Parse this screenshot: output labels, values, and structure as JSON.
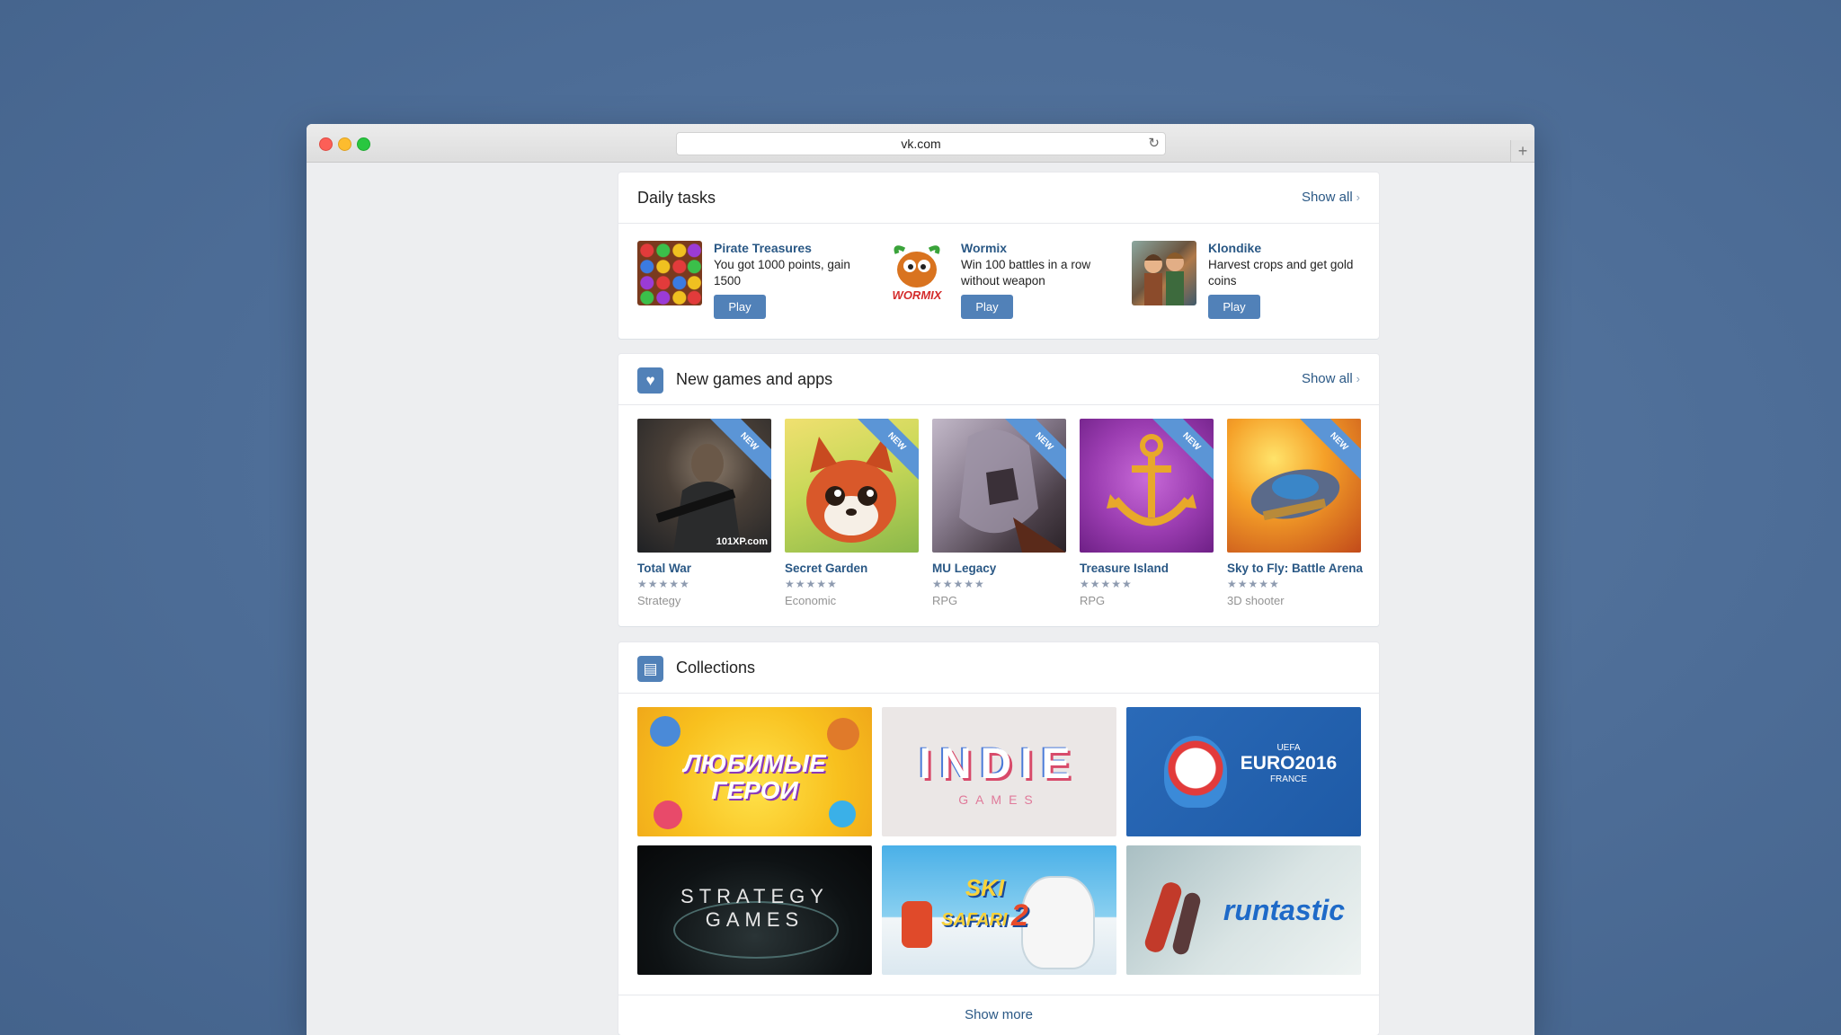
{
  "browser": {
    "url": "vk.com",
    "reload_icon": "↻",
    "new_tab_icon": "+"
  },
  "daily_tasks": {
    "title": "Daily tasks",
    "show_all": "Show all",
    "tasks": [
      {
        "name": "Pirate Treasures",
        "desc": "You got 1000 points, gain 1500",
        "button": "Play"
      },
      {
        "name": "Wormix",
        "desc": "Win 100 battles in a row without weapon",
        "button": "Play",
        "logo_text": "WORMIX"
      },
      {
        "name": "Klondike",
        "desc": "Harvest crops and get gold coins",
        "button": "Play"
      }
    ]
  },
  "new_games": {
    "title": "New games and apps",
    "show_all": "Show all",
    "games": [
      {
        "name": "Total War",
        "genre": "Strategy",
        "badge": "NEW",
        "rating": 4.5,
        "stars": "★★★★★",
        "watermark": "101XP.com"
      },
      {
        "name": "Secret Garden",
        "genre": "Economic",
        "badge": "NEW",
        "rating": 5,
        "stars": "★★★★★"
      },
      {
        "name": "MU Legacy",
        "genre": "RPG",
        "badge": "NEW",
        "rating": 4.5,
        "stars": "★★★★★"
      },
      {
        "name": "Treasure Island",
        "genre": "RPG",
        "badge": "NEW",
        "rating": 4.5,
        "stars": "★★★★★"
      },
      {
        "name": "Sky to Fly: Battle Arena",
        "genre": "3D shooter",
        "badge": "NEW",
        "rating": 5,
        "stars": "★★★★★"
      }
    ]
  },
  "collections": {
    "title": "Collections",
    "show_more": "Show more",
    "items": [
      {
        "line1": "ЛЮБИМЫЕ",
        "line2": "ГЕРОИ"
      },
      {
        "line1": "INDIE",
        "line2": "GAMES"
      },
      {
        "line1": "UEFA",
        "line2": "EURO2016",
        "line3": "FRANCE"
      },
      {
        "line1": "STRATEGY",
        "line2": "GAMES"
      },
      {
        "line1": "SKI",
        "line2": "SAFARI",
        "line3": "2"
      },
      {
        "line1": "runtastic"
      }
    ]
  },
  "colors": {
    "accent": "#5181b8",
    "link": "#2a5885",
    "badge": "#5b95d6"
  }
}
